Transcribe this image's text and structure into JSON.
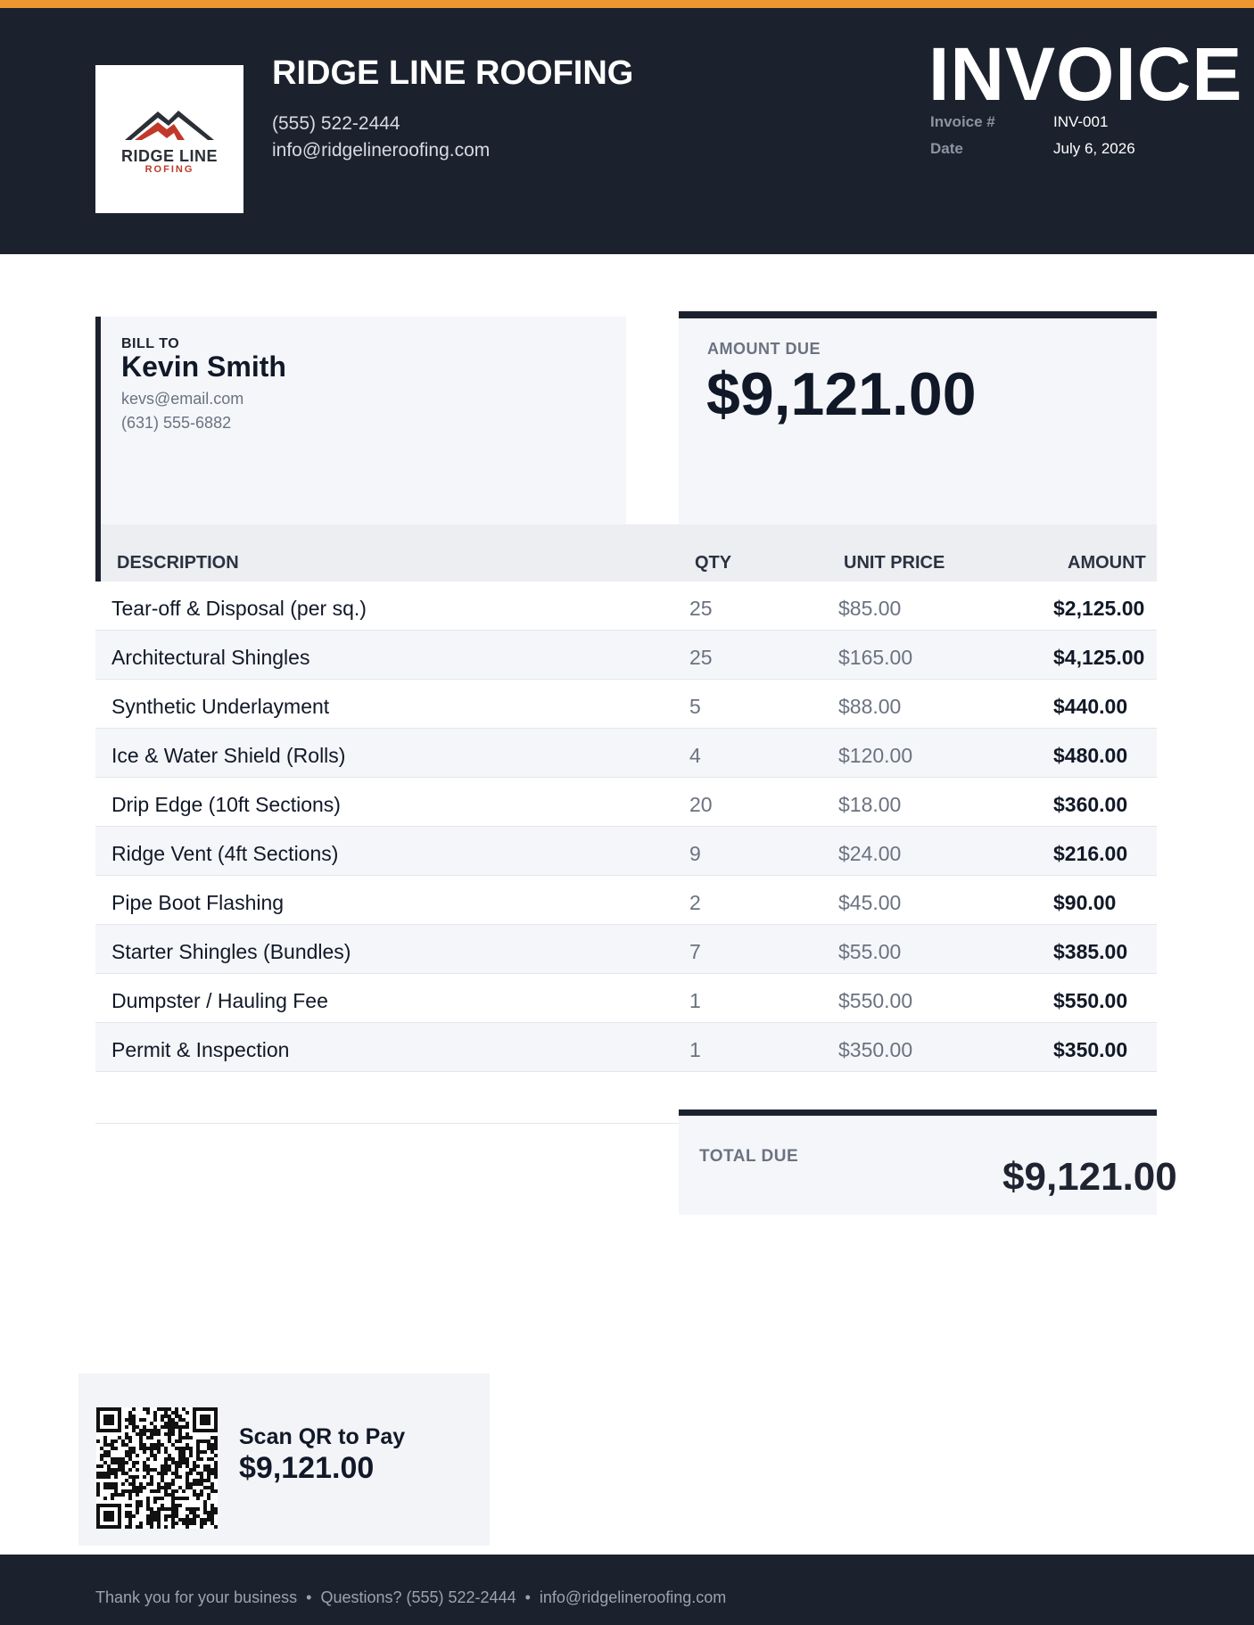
{
  "company": {
    "name": "RIDGE LINE ROOFING",
    "phone": "(555) 522-2444",
    "email": "info@ridgelineroofing.com",
    "logo_text_1": "RIDGE LINE",
    "logo_text_2": "ROFING"
  },
  "invoice": {
    "title": "INVOICE",
    "number_label": "Invoice #",
    "number": "INV-001",
    "date_label": "Date",
    "date": "July 6, 2026"
  },
  "bill_to": {
    "label": "BILL TO",
    "name": "Kevin Smith",
    "email": "kevs@email.com",
    "phone": "(631) 555-6882"
  },
  "amount_due": {
    "label": "AMOUNT DUE",
    "value": "$9,121.00"
  },
  "table": {
    "headers": [
      "DESCRIPTION",
      "QTY",
      "UNIT PRICE",
      "AMOUNT"
    ],
    "rows": [
      {
        "desc": "Tear-off & Disposal (per sq.)",
        "qty": "25",
        "price": "$85.00",
        "amount": "$2,125.00"
      },
      {
        "desc": "Architectural Shingles",
        "qty": "25",
        "price": "$165.00",
        "amount": "$4,125.00"
      },
      {
        "desc": "Synthetic Underlayment",
        "qty": "5",
        "price": "$88.00",
        "amount": "$440.00"
      },
      {
        "desc": "Ice & Water Shield (Rolls)",
        "qty": "4",
        "price": "$120.00",
        "amount": "$480.00"
      },
      {
        "desc": "Drip Edge (10ft Sections)",
        "qty": "20",
        "price": "$18.00",
        "amount": "$360.00"
      },
      {
        "desc": "Ridge Vent (4ft Sections)",
        "qty": "9",
        "price": "$24.00",
        "amount": "$216.00"
      },
      {
        "desc": "Pipe Boot Flashing",
        "qty": "2",
        "price": "$45.00",
        "amount": "$90.00"
      },
      {
        "desc": "Starter Shingles (Bundles)",
        "qty": "7",
        "price": "$55.00",
        "amount": "$385.00"
      },
      {
        "desc": "Dumpster / Hauling Fee",
        "qty": "1",
        "price": "$550.00",
        "amount": "$550.00"
      },
      {
        "desc": "Permit & Inspection",
        "qty": "1",
        "price": "$350.00",
        "amount": "$350.00"
      }
    ]
  },
  "total": {
    "label": "TOTAL DUE",
    "value": "$9,121.00"
  },
  "qr": {
    "title": "Scan QR to Pay",
    "amount": "$9,121.00"
  },
  "footer": {
    "thanks": "Thank you for your business",
    "questions": "Questions? (555) 522-2444",
    "email": "info@ridgelineroofing.com",
    "separator": "•"
  },
  "colors": {
    "accent": "#f0962f",
    "header_bg": "#1c222d",
    "logo_red": "#c0392b"
  }
}
